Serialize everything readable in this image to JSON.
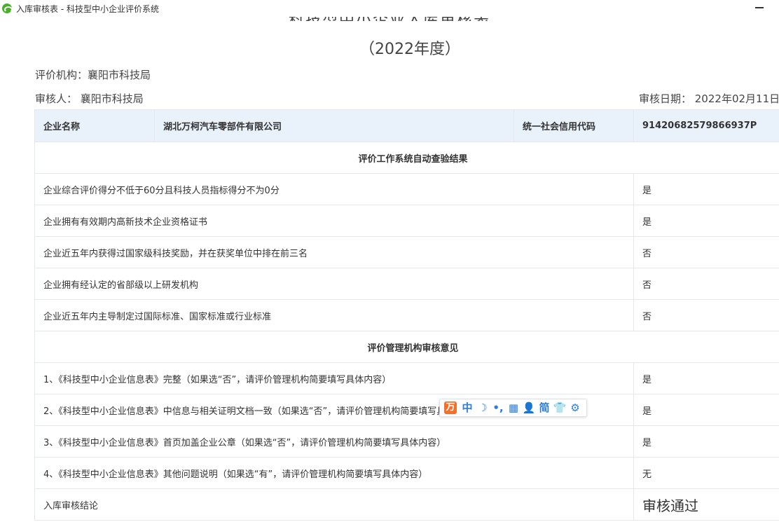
{
  "window": {
    "title": "入库审核表 - 科技型中小企业评价系统"
  },
  "header": {
    "title_cut": "科技型中小企业入库审核表",
    "year": "（2022年度）",
    "org_label": "评价机构：襄阳市科技局",
    "reviewer_label": "审核人： 襄阳市科技局",
    "date_label": "审核日期： 2022年02月11日"
  },
  "table": {
    "company_name_label": "企业名称",
    "company_name_value": "湖北万柯汽车零部件有限公司",
    "credit_code_label": "统一社会信用代码",
    "credit_code_value": "91420682579866937P",
    "section1": "评价工作系统自动查验结果",
    "auto_checks": [
      {
        "item": "企业综合评价得分不低于60分且科技人员指标得分不为0分",
        "result": "是"
      },
      {
        "item": "企业拥有有效期内高新技术企业资格证书",
        "result": "是"
      },
      {
        "item": "企业近五年内获得过国家级科技奖励，并在获奖单位中排在前三名",
        "result": "否"
      },
      {
        "item": "企业拥有经认定的省部级以上研发机构",
        "result": "否"
      },
      {
        "item": "企业近五年内主导制定过国际标准、国家标准或行业标准",
        "result": "否"
      }
    ],
    "section2": "评价管理机构审核意见",
    "reviews": [
      {
        "item": "1、《科技型中小企业信息表》完整（如果选“否”，请评价管理机构简要填写具体内容）",
        "result": "是"
      },
      {
        "item": "2、《科技型中小企业信息表》中信息与相关证明文档一致（如果选“否”，请评价管理机构简要填写具体内容）",
        "result": "是"
      },
      {
        "item": "3、《科技型中小企业信息表》首页加盖企业公章（如果选“否”，请评价管理机构简要填写具体内容）",
        "result": "是"
      },
      {
        "item": "4、《科技型中小企业信息表》其他问题说明（如果选“有”，请评价管理机构简要填写具体内容）",
        "result": "无"
      }
    ],
    "conclusion_label": "入库审核结论",
    "conclusion_value": "审核通过"
  },
  "ime_toolbar": {
    "logo": "万",
    "items": [
      "中",
      "☽",
      "•,",
      "▦",
      "👤",
      "简",
      "👕",
      "⚙"
    ]
  },
  "colors": {
    "header_bg": "#e9f1fb",
    "border": "#e3e8ee",
    "pass_green": "#3aa043",
    "ime_accent": "#2a7de1",
    "ime_logo": "#f3702b"
  }
}
